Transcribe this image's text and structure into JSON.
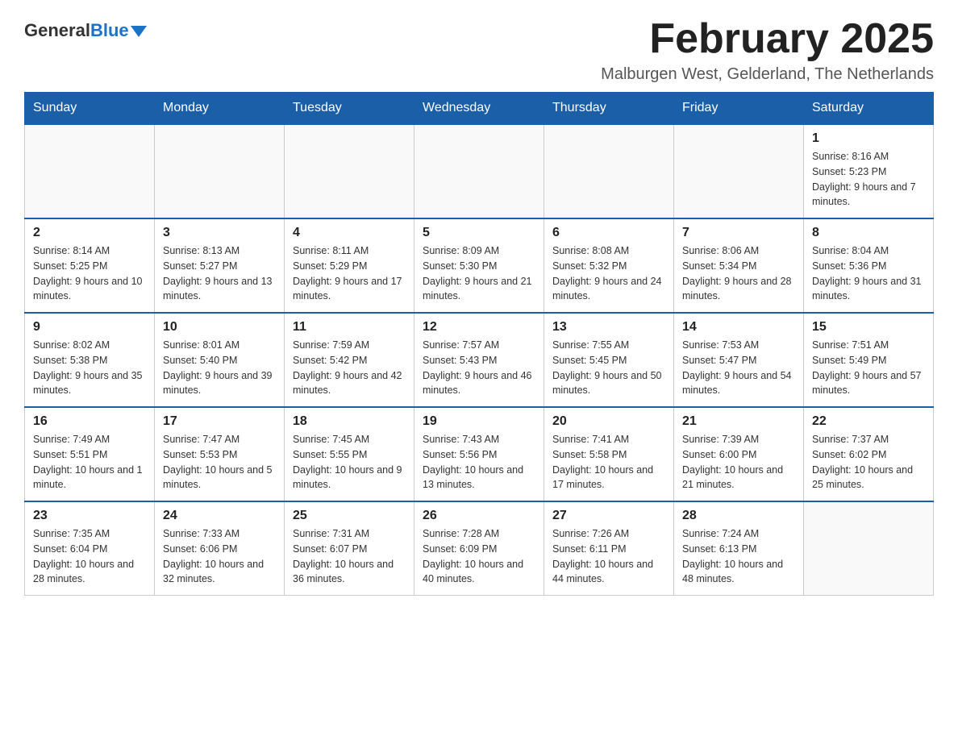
{
  "header": {
    "logo": {
      "general": "General",
      "blue": "Blue"
    },
    "title": "February 2025",
    "location": "Malburgen West, Gelderland, The Netherlands"
  },
  "calendar": {
    "days_of_week": [
      "Sunday",
      "Monday",
      "Tuesday",
      "Wednesday",
      "Thursday",
      "Friday",
      "Saturday"
    ],
    "weeks": [
      [
        {
          "day": "",
          "info": ""
        },
        {
          "day": "",
          "info": ""
        },
        {
          "day": "",
          "info": ""
        },
        {
          "day": "",
          "info": ""
        },
        {
          "day": "",
          "info": ""
        },
        {
          "day": "",
          "info": ""
        },
        {
          "day": "1",
          "info": "Sunrise: 8:16 AM\nSunset: 5:23 PM\nDaylight: 9 hours and 7 minutes."
        }
      ],
      [
        {
          "day": "2",
          "info": "Sunrise: 8:14 AM\nSunset: 5:25 PM\nDaylight: 9 hours and 10 minutes."
        },
        {
          "day": "3",
          "info": "Sunrise: 8:13 AM\nSunset: 5:27 PM\nDaylight: 9 hours and 13 minutes."
        },
        {
          "day": "4",
          "info": "Sunrise: 8:11 AM\nSunset: 5:29 PM\nDaylight: 9 hours and 17 minutes."
        },
        {
          "day": "5",
          "info": "Sunrise: 8:09 AM\nSunset: 5:30 PM\nDaylight: 9 hours and 21 minutes."
        },
        {
          "day": "6",
          "info": "Sunrise: 8:08 AM\nSunset: 5:32 PM\nDaylight: 9 hours and 24 minutes."
        },
        {
          "day": "7",
          "info": "Sunrise: 8:06 AM\nSunset: 5:34 PM\nDaylight: 9 hours and 28 minutes."
        },
        {
          "day": "8",
          "info": "Sunrise: 8:04 AM\nSunset: 5:36 PM\nDaylight: 9 hours and 31 minutes."
        }
      ],
      [
        {
          "day": "9",
          "info": "Sunrise: 8:02 AM\nSunset: 5:38 PM\nDaylight: 9 hours and 35 minutes."
        },
        {
          "day": "10",
          "info": "Sunrise: 8:01 AM\nSunset: 5:40 PM\nDaylight: 9 hours and 39 minutes."
        },
        {
          "day": "11",
          "info": "Sunrise: 7:59 AM\nSunset: 5:42 PM\nDaylight: 9 hours and 42 minutes."
        },
        {
          "day": "12",
          "info": "Sunrise: 7:57 AM\nSunset: 5:43 PM\nDaylight: 9 hours and 46 minutes."
        },
        {
          "day": "13",
          "info": "Sunrise: 7:55 AM\nSunset: 5:45 PM\nDaylight: 9 hours and 50 minutes."
        },
        {
          "day": "14",
          "info": "Sunrise: 7:53 AM\nSunset: 5:47 PM\nDaylight: 9 hours and 54 minutes."
        },
        {
          "day": "15",
          "info": "Sunrise: 7:51 AM\nSunset: 5:49 PM\nDaylight: 9 hours and 57 minutes."
        }
      ],
      [
        {
          "day": "16",
          "info": "Sunrise: 7:49 AM\nSunset: 5:51 PM\nDaylight: 10 hours and 1 minute."
        },
        {
          "day": "17",
          "info": "Sunrise: 7:47 AM\nSunset: 5:53 PM\nDaylight: 10 hours and 5 minutes."
        },
        {
          "day": "18",
          "info": "Sunrise: 7:45 AM\nSunset: 5:55 PM\nDaylight: 10 hours and 9 minutes."
        },
        {
          "day": "19",
          "info": "Sunrise: 7:43 AM\nSunset: 5:56 PM\nDaylight: 10 hours and 13 minutes."
        },
        {
          "day": "20",
          "info": "Sunrise: 7:41 AM\nSunset: 5:58 PM\nDaylight: 10 hours and 17 minutes."
        },
        {
          "day": "21",
          "info": "Sunrise: 7:39 AM\nSunset: 6:00 PM\nDaylight: 10 hours and 21 minutes."
        },
        {
          "day": "22",
          "info": "Sunrise: 7:37 AM\nSunset: 6:02 PM\nDaylight: 10 hours and 25 minutes."
        }
      ],
      [
        {
          "day": "23",
          "info": "Sunrise: 7:35 AM\nSunset: 6:04 PM\nDaylight: 10 hours and 28 minutes."
        },
        {
          "day": "24",
          "info": "Sunrise: 7:33 AM\nSunset: 6:06 PM\nDaylight: 10 hours and 32 minutes."
        },
        {
          "day": "25",
          "info": "Sunrise: 7:31 AM\nSunset: 6:07 PM\nDaylight: 10 hours and 36 minutes."
        },
        {
          "day": "26",
          "info": "Sunrise: 7:28 AM\nSunset: 6:09 PM\nDaylight: 10 hours and 40 minutes."
        },
        {
          "day": "27",
          "info": "Sunrise: 7:26 AM\nSunset: 6:11 PM\nDaylight: 10 hours and 44 minutes."
        },
        {
          "day": "28",
          "info": "Sunrise: 7:24 AM\nSunset: 6:13 PM\nDaylight: 10 hours and 48 minutes."
        },
        {
          "day": "",
          "info": ""
        }
      ]
    ]
  }
}
